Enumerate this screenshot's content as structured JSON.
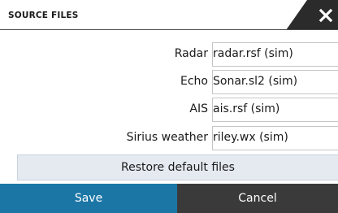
{
  "dialog": {
    "title": "SOURCE FILES",
    "close_icon": "close-icon"
  },
  "sources": [
    {
      "label": "Radar",
      "value": "radar.rsf (sim)"
    },
    {
      "label": "Echo",
      "value": "Sonar.sl2 (sim)"
    },
    {
      "label": "AIS",
      "value": "ais.rsf (sim)"
    },
    {
      "label": "Sirius weather",
      "value": "riley.wx (sim)"
    }
  ],
  "restore_label": "Restore default files",
  "buttons": {
    "save": "Save",
    "cancel": "Cancel"
  },
  "colors": {
    "save_button": "#1b76a6",
    "cancel_button": "#3a3a3a",
    "restore_bg": "#e5eaf1"
  }
}
